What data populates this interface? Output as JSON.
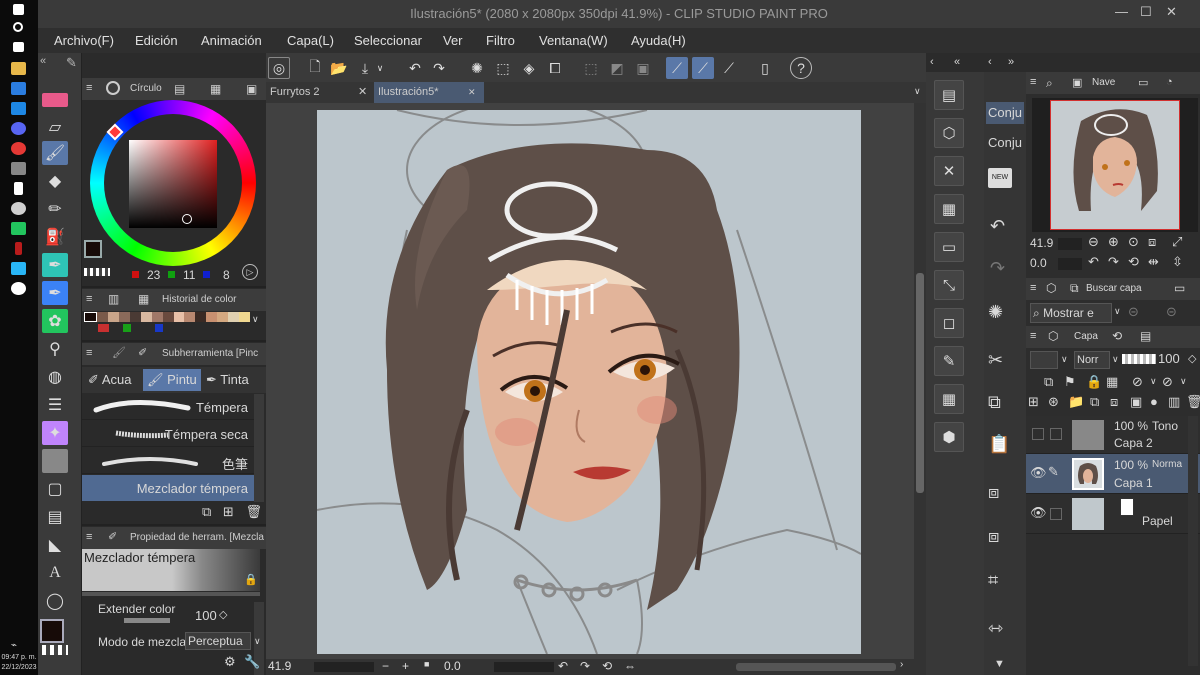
{
  "window": {
    "title": "Ilustración5* (2080 x 2080px 350dpi 41.9%) - CLIP STUDIO PAINT PRO",
    "controls": [
      "—",
      "☐",
      "✕"
    ]
  },
  "taskbar": {
    "time": "09:47 p. m.",
    "date": "22/12/2023"
  },
  "menu": [
    "Archivo(F)",
    "Edición",
    "Animación",
    "Capa(L)",
    "Seleccionar",
    "Ver",
    "Filtro",
    "Ventana(W)",
    "Ayuda(H)"
  ],
  "canvas_tabs": [
    {
      "label": "Furrytos 2",
      "close": "✕"
    },
    {
      "label": "Ilustración5*",
      "close": "✕"
    }
  ],
  "color_panel": {
    "tab_label": "Círculo",
    "r": "23",
    "g": "11",
    "b": "8"
  },
  "color_history": {
    "label": "Historial de color"
  },
  "subtool_panel": {
    "header": "Subherramienta [Pinc",
    "groups": [
      "Acua",
      "Pintu",
      "Tinta"
    ],
    "brushes": [
      "Témpera",
      "Témpera seca",
      "色筆",
      "Mezclador témpera"
    ]
  },
  "tool_property": {
    "header": "Propiedad de herram. [Mezcla",
    "tool_name": "Mezclador témpera",
    "extend_color_label": "Extender color",
    "extend_color_value": "100",
    "blend_mode_label": "Modo de mezcla",
    "blend_mode_value": "Perceptua"
  },
  "status": {
    "zoom": "41.9",
    "rotation": "0.0"
  },
  "navigator": {
    "tab_label": "Nave",
    "zoom": "41.9",
    "rotation": "0.0"
  },
  "right_left_tabs": [
    "Conju",
    "Conju"
  ],
  "layer_search": {
    "label": "Buscar capa",
    "mode": "Mostrar e"
  },
  "layers_panel": {
    "label": "Capa",
    "blend": "Norr",
    "opacity": "100",
    "layers": [
      {
        "opacity": "100 %",
        "mode": "Tono",
        "name": "Capa 2"
      },
      {
        "opacity": "100 %",
        "mode": "Norma",
        "name": "Capa 1"
      },
      {
        "opacity": "",
        "mode": "",
        "name": "Papel"
      }
    ]
  },
  "colors": {
    "accent": "#5a78a8",
    "canvas_bg": "#bcc6cc",
    "main_color": "#170b08"
  }
}
